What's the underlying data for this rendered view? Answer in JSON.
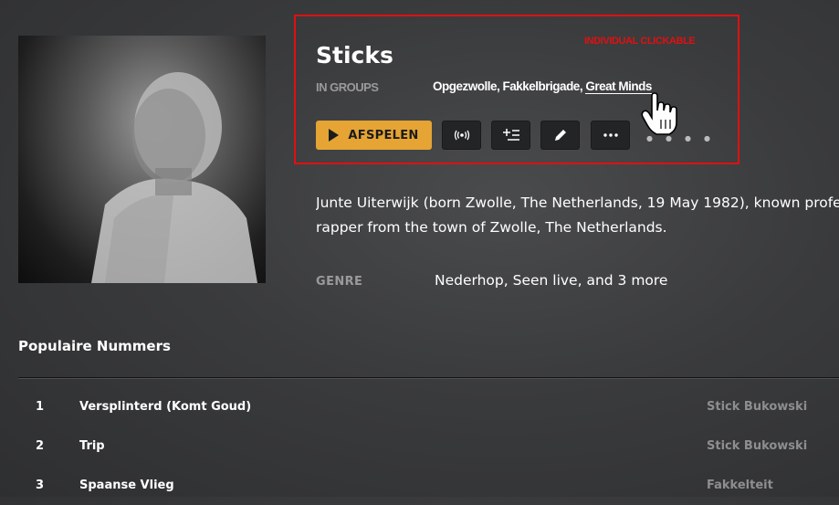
{
  "artist": {
    "name": "Sticks",
    "groups_label": "IN GROUPS",
    "groups": [
      "Opgezwolle",
      "Fakkelbrigade",
      "Great Minds"
    ],
    "bio_lines": [
      "Junte Uiterwijk (born Zwolle, The Netherlands, 19 May 1982), known profe",
      "rapper from the town of Zwolle, The Netherlands."
    ],
    "genre_label": "GENRE",
    "genre_value": "Nederhop, Seen live, and 3 more"
  },
  "annotation": "INDIVIDUAL CLICKABLE",
  "actions": {
    "play_label": "AFSPELEN",
    "radio_icon": "radio-icon",
    "add_to_queue_icon": "add-to-queue-icon",
    "edit_icon": "pencil-icon",
    "more_icon": "more-icon"
  },
  "popular": {
    "title": "Populaire Nummers",
    "tracks": [
      {
        "num": "1",
        "title": "Versplinterd (Komt Goud)",
        "artist": "Stick Bukowski"
      },
      {
        "num": "2",
        "title": "Trip",
        "artist": "Stick Bukowski"
      },
      {
        "num": "3",
        "title": "Spaanse Vlieg",
        "artist": "Fakkelteit"
      }
    ]
  },
  "colors": {
    "accent": "#e5a434",
    "highlight_border": "#e01010"
  }
}
